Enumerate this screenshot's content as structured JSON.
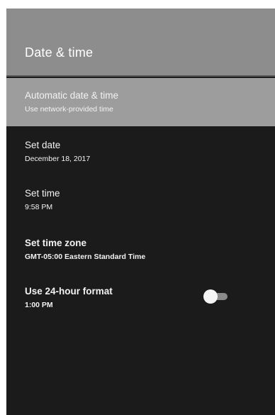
{
  "header": {
    "title": "Date & time"
  },
  "settings": {
    "items": [
      {
        "title": "Automatic date & time",
        "subtitle": "Use network-provided time"
      },
      {
        "title": "Set date",
        "subtitle": "December 18, 2017"
      },
      {
        "title": "Set time",
        "subtitle": "9:58 PM"
      },
      {
        "title": "Set time zone",
        "subtitle": "GMT-05:00 Eastern Standard Time"
      },
      {
        "title": "Use 24-hour format",
        "subtitle": "1:00 PM"
      }
    ],
    "use_24_hour_format_enabled": false
  },
  "colors": {
    "header_bg": "#8d8d8d",
    "selected_row_bg": "#9d9d9d",
    "panel_bg": "#1b1b1b",
    "text": "#f2f2f2"
  }
}
